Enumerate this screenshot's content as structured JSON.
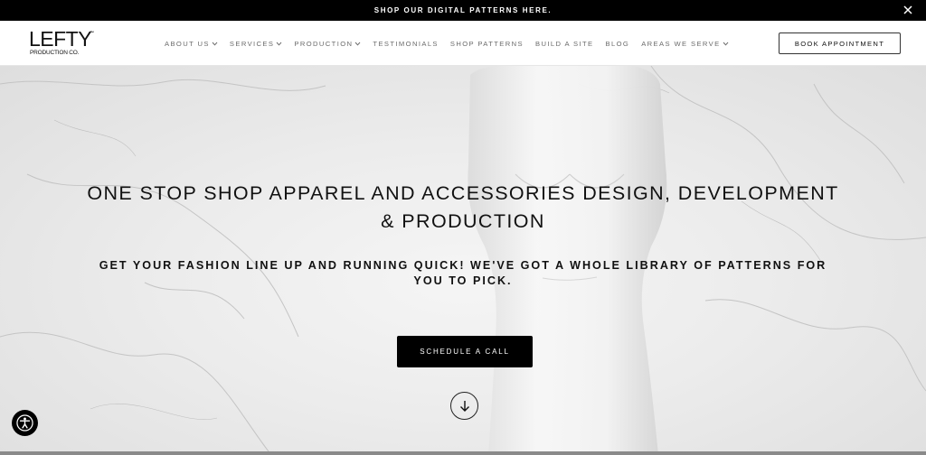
{
  "announcement": {
    "text": "SHOP OUR DIGITAL PATTERNS HERE.",
    "close_icon": "close-icon"
  },
  "logo": {
    "main": "LEFTY",
    "tm": "™",
    "sub": "PRODUCTION CO."
  },
  "nav": {
    "items": [
      {
        "label": "ABOUT US",
        "dropdown": true
      },
      {
        "label": "SERVICES",
        "dropdown": true
      },
      {
        "label": "PRODUCTION",
        "dropdown": true
      },
      {
        "label": "TESTIMONIALS",
        "dropdown": false
      },
      {
        "label": "SHOP PATTERNS",
        "dropdown": false
      },
      {
        "label": "BUILD A SITE",
        "dropdown": false
      },
      {
        "label": "BLOG",
        "dropdown": false
      },
      {
        "label": "AREAS WE SERVE",
        "dropdown": true
      }
    ],
    "book_label": "BOOK APPOINTMENT"
  },
  "hero": {
    "headline": "ONE STOP SHOP APPAREL AND ACCESSORIES DESIGN, DEVELOPMENT & PRODUCTION",
    "subline": "GET YOUR FASHION LINE UP AND RUNNING QUICK! WE'VE GOT A WHOLE LIBRARY OF PATTERNS FOR YOU TO PICK.",
    "cta_label": "SCHEDULE A CALL",
    "scroll_icon": "arrow-down-icon"
  },
  "accessibility": {
    "icon": "accessibility-icon"
  },
  "colors": {
    "accent": "#000000",
    "nav_text": "#6b6b6b",
    "background": "#ececec"
  }
}
